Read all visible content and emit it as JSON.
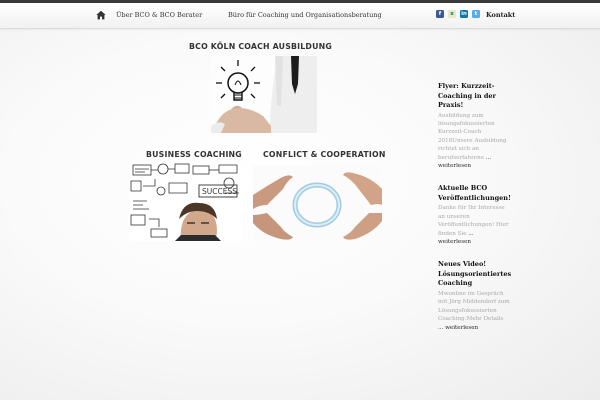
{
  "nav": {
    "items": [
      {
        "label": "Über BCO & BCO Berater"
      },
      {
        "label": "Büro für Coaching und Organisationsberatung"
      }
    ],
    "social": [
      {
        "icon": "facebook-icon",
        "glyph": "f",
        "color": "#3b5998"
      },
      {
        "icon": "xing-icon",
        "glyph": "x",
        "color": "#e9e9c8"
      },
      {
        "icon": "linkedin-icon",
        "glyph": "in",
        "color": "#0e76a8"
      },
      {
        "icon": "twitter-icon",
        "glyph": "t",
        "color": "#55acee"
      }
    ],
    "contact_label": "Kontakt"
  },
  "main": {
    "featured_title": "BCO KÖLN COACH AUSBILDUNG",
    "tiles": [
      {
        "title": "BUSINESS COACHING"
      },
      {
        "title": "CONFLICT & COOPERATION"
      }
    ],
    "sketch_word": "SUCCESS"
  },
  "sidebar": {
    "posts": [
      {
        "title": "Flyer: Kurzzeit-Coaching in der Praxis!",
        "excerpt": "Ausbildung zum lösungsfokussierten Kurzzeit-Coach 2018Unsere Ausbildung richtet sich an berufserfahrene",
        "ellipsis": "...",
        "more": "weiterlesen"
      },
      {
        "title": "Aktuelle BCO Veröffentlichungen!",
        "excerpt": "Danke für Ihr Interesse an unseren Veröffentlichungen! Hier finden Sie",
        "ellipsis": "...",
        "more": "weiterlesen"
      },
      {
        "title": "Neues Video! Lösungsorientiertes Coaching",
        "excerpt": "Mwonline im Gespräch mit Jörg Middendorf zum Lösungsfokussierten Coaching.Mehr Details",
        "ellipsis": "...",
        "more": "weiterlesen"
      }
    ]
  },
  "colors": {
    "accent": "#222222",
    "muted_text": "#a8a8a8"
  }
}
